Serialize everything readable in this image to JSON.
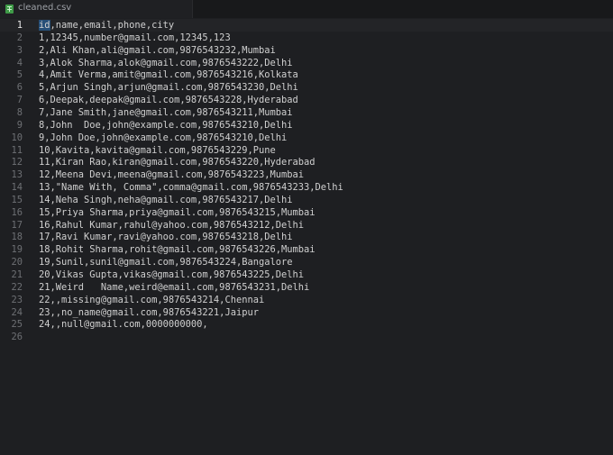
{
  "tab": {
    "title": "cleaned.csv",
    "icon": "csv-file-icon",
    "icon_color": "#3f9b48"
  },
  "editor": {
    "cursor_line": 1,
    "lines": [
      {
        "n": "1",
        "text": "id,name,email,phone,city"
      },
      {
        "n": "2",
        "text": "1,12345,number@gmail.com,12345,123"
      },
      {
        "n": "3",
        "text": "2,Ali Khan,ali@gmail.com,9876543232,Mumbai"
      },
      {
        "n": "4",
        "text": "3,Alok Sharma,alok@gmail.com,9876543222,Delhi"
      },
      {
        "n": "5",
        "text": "4,Amit Verma,amit@gmail.com,9876543216,Kolkata"
      },
      {
        "n": "6",
        "text": "5,Arjun Singh,arjun@gmail.com,9876543230,Delhi"
      },
      {
        "n": "7",
        "text": "6,Deepak,deepak@gmail.com,9876543228,Hyderabad"
      },
      {
        "n": "8",
        "text": "7,Jane Smith,jane@gmail.com,9876543211,Mumbai"
      },
      {
        "n": "9",
        "text": "8,John  Doe,john@example.com,9876543210,Delhi"
      },
      {
        "n": "10",
        "text": "9,John Doe,john@example.com,9876543210,Delhi"
      },
      {
        "n": "11",
        "text": "10,Kavita,kavita@gmail.com,9876543229,Pune"
      },
      {
        "n": "12",
        "text": "11,Kiran Rao,kiran@gmail.com,9876543220,Hyderabad"
      },
      {
        "n": "13",
        "text": "12,Meena Devi,meena@gmail.com,9876543223,Mumbai"
      },
      {
        "n": "14",
        "text": "13,\"Name With, Comma\",comma@gmail.com,9876543233,Delhi"
      },
      {
        "n": "15",
        "text": "14,Neha Singh,neha@gmail.com,9876543217,Delhi"
      },
      {
        "n": "16",
        "text": "15,Priya Sharma,priya@gmail.com,9876543215,Mumbai"
      },
      {
        "n": "17",
        "text": "16,Rahul Kumar,rahul@yahoo.com,9876543212,Delhi"
      },
      {
        "n": "18",
        "text": "17,Ravi Kumar,ravi@yahoo.com,9876543218,Delhi"
      },
      {
        "n": "19",
        "text": "18,Rohit Sharma,rohit@gmail.com,9876543226,Mumbai"
      },
      {
        "n": "20",
        "text": "19,Sunil,sunil@gmail.com,9876543224,Bangalore"
      },
      {
        "n": "21",
        "text": "20,Vikas Gupta,vikas@gmail.com,9876543225,Delhi"
      },
      {
        "n": "22",
        "text": "21,Weird   Name,weird@email.com,9876543231,Delhi"
      },
      {
        "n": "23",
        "text": "22,,missing@gmail.com,9876543214,Chennai"
      },
      {
        "n": "24",
        "text": "23,,no_name@gmail.com,9876543221,Jaipur"
      },
      {
        "n": "25",
        "text": "24,,null@gmail.com,0000000000,"
      },
      {
        "n": "26",
        "text": ""
      }
    ]
  }
}
